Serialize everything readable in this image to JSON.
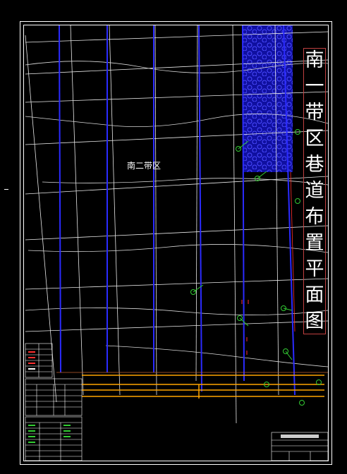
{
  "drawing": {
    "area_label": "南二带区",
    "title_chars": [
      "南",
      "一",
      "带",
      "区",
      "巷",
      "道",
      "布",
      "置",
      "平",
      "面",
      "图"
    ]
  },
  "colors": {
    "background": "#000000",
    "frame": "#ffffff",
    "roadway_blue": "#2b2bff",
    "hatch_blue": "#1a1acc",
    "pipe_orange": "#ffa500",
    "marker_green": "#33cc33",
    "accent_red": "#ff3030"
  }
}
